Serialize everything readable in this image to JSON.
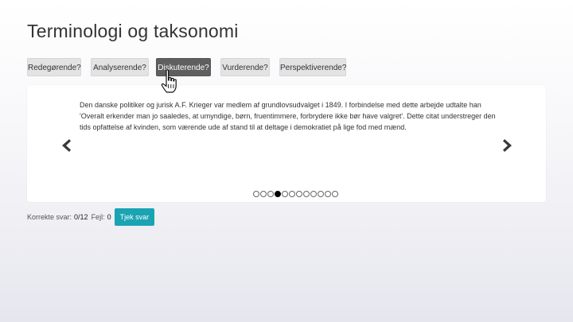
{
  "page": {
    "title": "Terminologi og taksonomi"
  },
  "options": [
    {
      "label": "Redegørende?",
      "active": false
    },
    {
      "label": "Analyserende?",
      "active": false
    },
    {
      "label": "Diskuterende?",
      "active": true
    },
    {
      "label": "Vurderende?",
      "active": false
    },
    {
      "label": "Perspektiverende?",
      "active": false
    }
  ],
  "carousel": {
    "passage": "Den danske politiker og jurisk A.F. Krieger var medlem af grundlovsudvalget i 1849. I forbindelse med dette arbejde udtalte han 'Overalt erkender man jo saaledes, at umyndige, børn, fruentimmere, forbrydere ikke bør have valgret'. Dette citat understreger den tids opfattelse af kvinden, som værende ude af stand til at deltage i demokratiet på lige fod med mænd.",
    "prev_icon": "chevron-left-icon",
    "next_icon": "chevron-right-icon",
    "dot_count": 12,
    "active_dot": 3
  },
  "footer": {
    "correct_label": "Korrekte svar:",
    "correct_value": "0/12",
    "errors_label": "Fejl:",
    "errors_value": "0",
    "check_button": "Tjek svar"
  },
  "colors": {
    "accent": "#1aa3b3",
    "active_button": "#5f5f5f",
    "button_bg": "#e3e3e3"
  }
}
